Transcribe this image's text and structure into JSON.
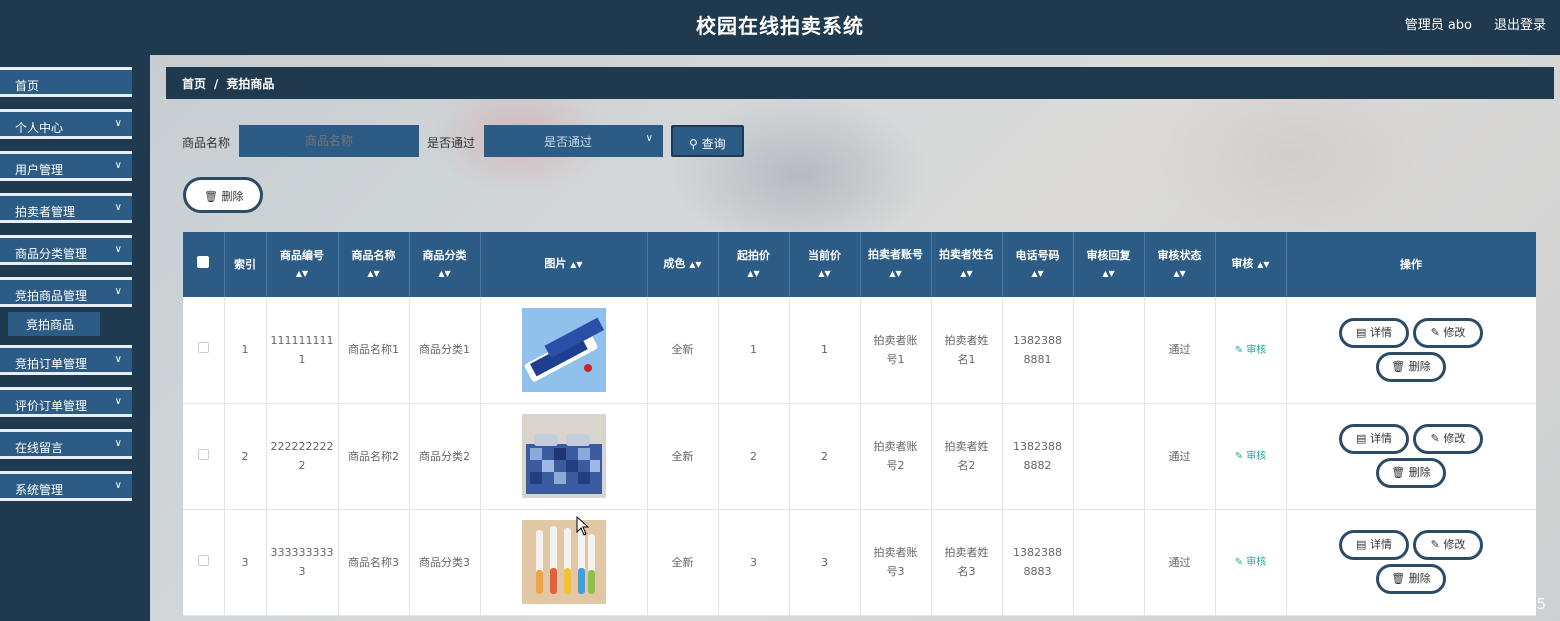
{
  "header": {
    "title": "校园在线拍卖系统",
    "user": "管理员 abo",
    "logout": "退出登录"
  },
  "sidebar": {
    "items": [
      {
        "label": "首页"
      },
      {
        "label": "个人中心"
      },
      {
        "label": "用户管理"
      },
      {
        "label": "拍卖者管理"
      },
      {
        "label": "商品分类管理"
      },
      {
        "label": "竞拍商品管理"
      },
      {
        "label": "竞拍订单管理"
      },
      {
        "label": "评价订单管理"
      },
      {
        "label": "在线留言"
      },
      {
        "label": "系统管理"
      }
    ],
    "active_sub": "竞拍商品"
  },
  "breadcrumb": {
    "home": "首页",
    "sep": "/",
    "current": "竞拍商品"
  },
  "search": {
    "name_label": "商品名称",
    "name_placeholder": "商品名称",
    "pass_label": "是否通过",
    "pass_placeholder": "是否通过",
    "query_label": "查询",
    "delete_label": "删除"
  },
  "table": {
    "headers": {
      "index": "索引",
      "code": "商品编号",
      "name": "商品名称",
      "category": "商品分类",
      "image": "图片",
      "condition": "成色",
      "start_price": "起拍价",
      "current_price": "当前价",
      "seller_account": "拍卖者账号",
      "seller_name": "拍卖者姓名",
      "phone": "电话号码",
      "audit_reply": "审核回复",
      "audit_status": "审核状态",
      "audit": "审核",
      "ops": "操作"
    },
    "rows": [
      {
        "index": "1",
        "code": "1111111111",
        "name": "商品名称1",
        "category": "商品分类1",
        "condition": "全新",
        "start_price": "1",
        "current_price": "1",
        "seller_account": "拍卖者账号1",
        "seller_name": "拍卖者姓名1",
        "phone": "13823888881",
        "audit_reply": "",
        "audit_status": "通过",
        "image": "toothpaste"
      },
      {
        "index": "2",
        "code": "2222222222",
        "name": "商品名称2",
        "category": "商品分类2",
        "condition": "全新",
        "start_price": "2",
        "current_price": "2",
        "seller_account": "拍卖者账号2",
        "seller_name": "拍卖者姓名2",
        "phone": "13823888882",
        "audit_reply": "",
        "audit_status": "通过",
        "image": "bedding"
      },
      {
        "index": "3",
        "code": "3333333333",
        "name": "商品名称3",
        "category": "商品分类3",
        "condition": "全新",
        "start_price": "3",
        "current_price": "3",
        "seller_account": "拍卖者账号3",
        "seller_name": "拍卖者姓名3",
        "phone": "13823888883",
        "audit_reply": "",
        "audit_status": "通过",
        "image": "toothbrushes"
      }
    ],
    "audit_link": "审核",
    "ops": {
      "detail": "详情",
      "edit": "修改",
      "delete": "删除"
    }
  },
  "watermark": "CSDN @weixin_72790115",
  "icons": {
    "chevron": "chevron-down-icon",
    "search": "search-icon",
    "trash": "trash-icon",
    "detail": "document-icon",
    "edit": "pencil-icon",
    "sort": "sort-icon"
  }
}
